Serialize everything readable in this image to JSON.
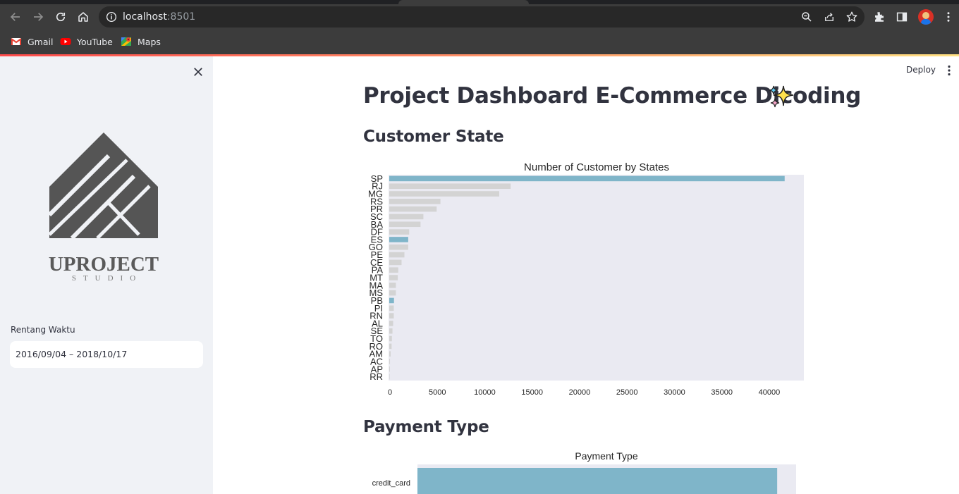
{
  "browser": {
    "url_host": "localhost",
    "url_port": ":8501",
    "bookmarks": [
      {
        "label": "Gmail",
        "icon": "gmail-icon"
      },
      {
        "label": "YouTube",
        "icon": "youtube-icon"
      },
      {
        "label": "Maps",
        "icon": "maps-icon"
      }
    ]
  },
  "sidebar": {
    "logo": {
      "text": "UPROJECT",
      "subtext": "STUDIO"
    },
    "date_label": "Rentang Waktu",
    "date_value": "2016/09/04 – 2018/10/17"
  },
  "header": {
    "deploy_label": "Deploy"
  },
  "main": {
    "title": "Project Dashboard E-Commerce Dicoding",
    "title_emoji": "sparkles-icon",
    "section_customer": "Customer State",
    "section_payment": "Payment Type"
  },
  "colors": {
    "highlight_bar": "#7fb5c9",
    "normal_bar": "#d3d3d3",
    "plot_bg": "#eaeaf2",
    "accent": "#ff4b4b"
  },
  "chart_data": [
    {
      "type": "bar",
      "orientation": "horizontal",
      "title": "Number of Customer by States",
      "categories": [
        "SP",
        "RJ",
        "MG",
        "RS",
        "PR",
        "SC",
        "BA",
        "DF",
        "ES",
        "GO",
        "PE",
        "CE",
        "PA",
        "MT",
        "MA",
        "MS",
        "PB",
        "PI",
        "RN",
        "AL",
        "SE",
        "TO",
        "RO",
        "AM",
        "AC",
        "AP",
        "RR"
      ],
      "values": [
        41700,
        12800,
        11600,
        5400,
        5000,
        3600,
        3300,
        2100,
        2000,
        2000,
        1600,
        1300,
        950,
        900,
        700,
        700,
        500,
        480,
        480,
        410,
        340,
        280,
        250,
        150,
        80,
        70,
        45
      ],
      "highlighted": [
        "SP",
        "ES",
        "PB"
      ],
      "xticks": [
        0,
        5000,
        10000,
        15000,
        20000,
        25000,
        30000,
        35000,
        40000
      ],
      "xlim": [
        0,
        43800
      ],
      "xlabel": "",
      "ylabel": "",
      "grid": false
    },
    {
      "type": "bar",
      "orientation": "horizontal",
      "title": "Payment Type",
      "categories": [
        "credit_card"
      ],
      "values": [
        76000
      ],
      "xlim": [
        0,
        80000
      ],
      "xlabel": "",
      "ylabel": "",
      "grid": false
    }
  ]
}
